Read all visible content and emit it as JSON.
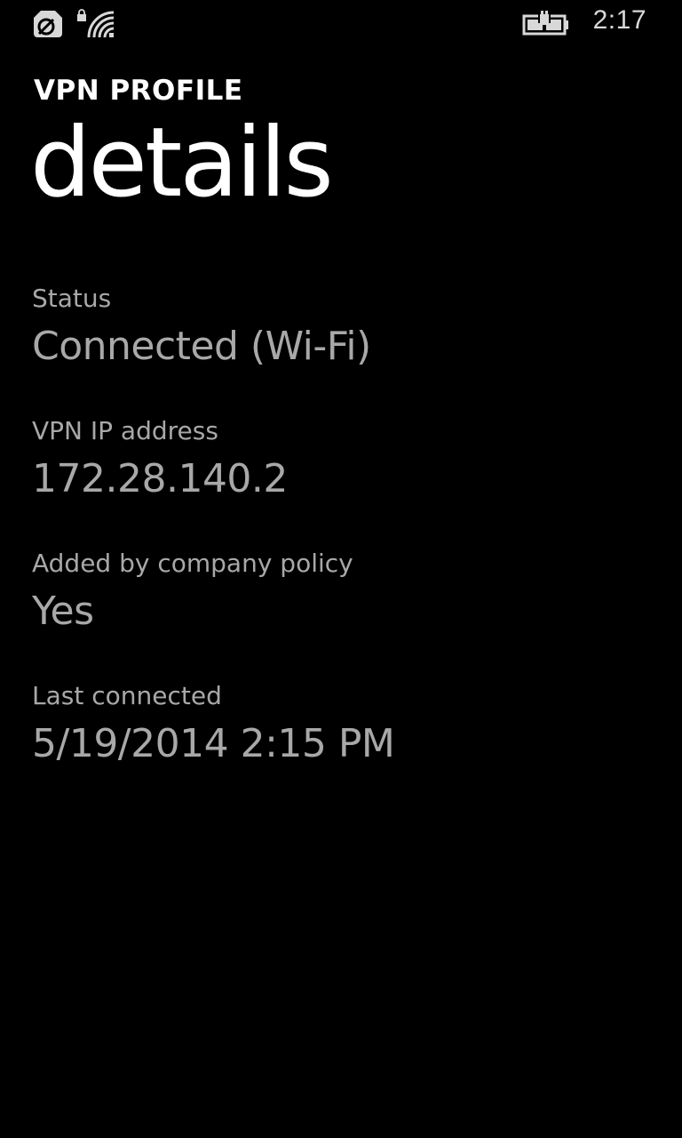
{
  "status_bar": {
    "time": "2:17",
    "icons": [
      "roaming-icon",
      "vpn-lock-icon",
      "wifi-icon",
      "battery-charging-icon"
    ]
  },
  "header": {
    "app_title": "VPN PROFILE",
    "page_title": "details"
  },
  "fields": [
    {
      "label": "Status",
      "value": "Connected (Wi-Fi)"
    },
    {
      "label": "VPN IP address",
      "value": "172.28.140.2"
    },
    {
      "label": "Added by company policy",
      "value": "Yes"
    },
    {
      "label": "Last connected",
      "value": "5/19/2014 2:15 PM"
    }
  ],
  "colors": {
    "background": "#000000",
    "title": "#ffffff",
    "text_secondary": "#a8a8a8"
  }
}
